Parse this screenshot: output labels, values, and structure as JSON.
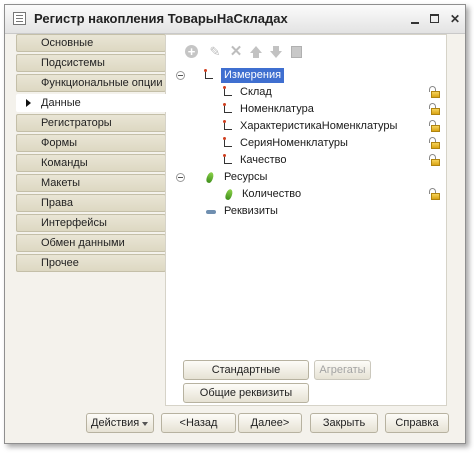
{
  "window": {
    "title": "Регистр накопления ТоварыНаСкладах"
  },
  "nav": {
    "items": [
      {
        "label": "Основные",
        "active": false
      },
      {
        "label": "Подсистемы",
        "active": false
      },
      {
        "label": "Функциональные опции",
        "active": false
      },
      {
        "label": "Данные",
        "active": true
      },
      {
        "label": "Регистраторы",
        "active": false
      },
      {
        "label": "Формы",
        "active": false
      },
      {
        "label": "Команды",
        "active": false
      },
      {
        "label": "Макеты",
        "active": false
      },
      {
        "label": "Права",
        "active": false
      },
      {
        "label": "Интерфейсы",
        "active": false
      },
      {
        "label": "Обмен данными",
        "active": false
      },
      {
        "label": "Прочее",
        "active": false
      }
    ]
  },
  "toolbar": {
    "icons": [
      "add-icon",
      "edit-icon",
      "delete-icon",
      "move-up-icon",
      "move-down-icon",
      "list-icon"
    ]
  },
  "tree": {
    "dimensions": {
      "label": "Измерения",
      "children": [
        "Склад",
        "Номенклатура",
        "ХарактеристикаНоменклатуры",
        "СерияНоменклатуры",
        "Качество"
      ]
    },
    "resources": {
      "label": "Ресурсы",
      "children": [
        "Количество"
      ]
    },
    "requisites": {
      "label": "Реквизиты"
    }
  },
  "panel_buttons": {
    "standard_requisites": "Стандартные реквизиты",
    "aggregates": "Агрегаты",
    "common_requisites": "Общие реквизиты"
  },
  "footer": {
    "actions": "Действия",
    "back": "<Назад",
    "next": "Далее>",
    "close": "Закрыть",
    "help": "Справка"
  },
  "colors": {
    "selection": "#3f6fd0",
    "nav_background": "#e9e5d5",
    "window_background": "#f4f2ec"
  }
}
